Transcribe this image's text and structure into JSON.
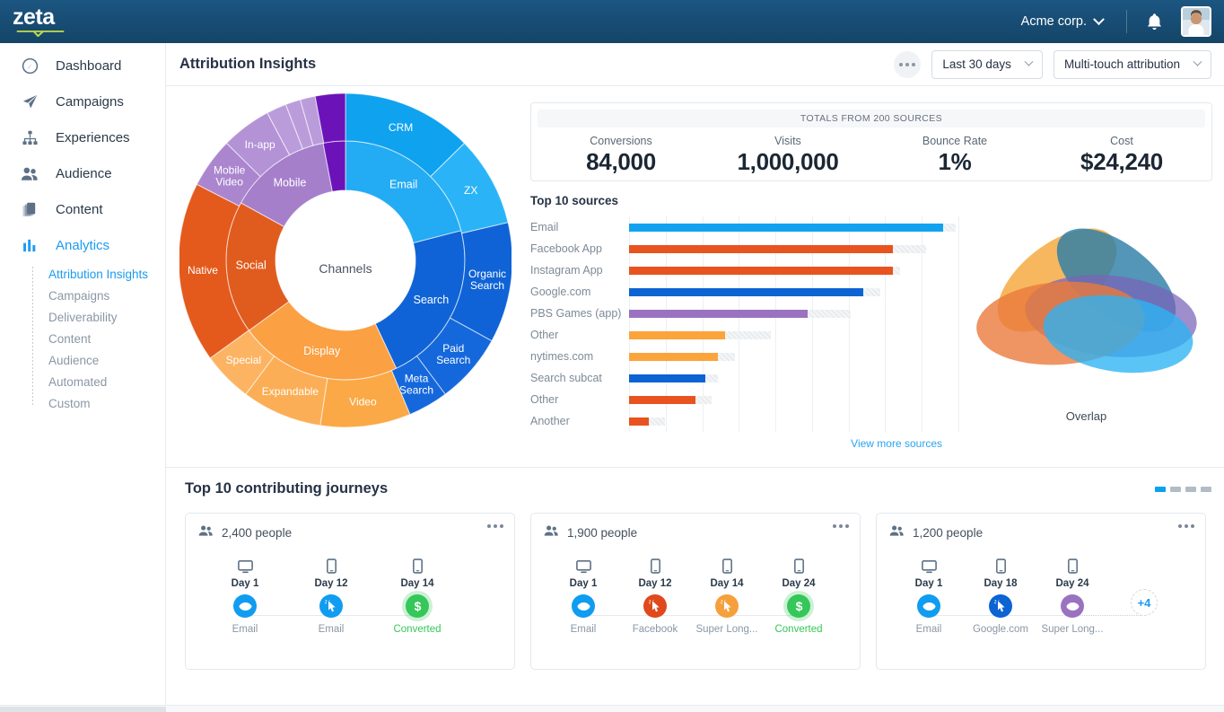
{
  "brand": {
    "logo_text": "zeta",
    "accent": "#1d9bf0",
    "topbar_bg": "#17507a"
  },
  "topbar": {
    "account": "Acme corp.",
    "bell_icon": "bell-icon",
    "avatar_icon": "user-avatar"
  },
  "sidebar": {
    "items": [
      {
        "label": "Dashboard",
        "icon": "gauge-icon"
      },
      {
        "label": "Campaigns",
        "icon": "paper-plane-icon"
      },
      {
        "label": "Experiences",
        "icon": "sitemap-icon"
      },
      {
        "label": "Audience",
        "icon": "people-icon"
      },
      {
        "label": "Content",
        "icon": "copy-icon"
      },
      {
        "label": "Analytics",
        "icon": "bar-chart-icon"
      }
    ],
    "subitems": [
      {
        "label": "Attribution Insights",
        "active": true
      },
      {
        "label": "Campaigns",
        "active": false
      },
      {
        "label": "Deliverability",
        "active": false
      },
      {
        "label": "Content",
        "active": false
      },
      {
        "label": "Audience",
        "active": false
      },
      {
        "label": "Automated",
        "active": false
      },
      {
        "label": "Custom",
        "active": false
      }
    ]
  },
  "header": {
    "title": "Attribution Insights",
    "more_icon": "ellipsis-icon",
    "date_range": "Last 30 days",
    "attribution_model": "Multi-touch attribution"
  },
  "stats": {
    "banner": "TOTALS FROM 200 SOURCES",
    "items": [
      {
        "label": "Conversions",
        "value": "84,000"
      },
      {
        "label": "Visits",
        "value": "1,000,000"
      },
      {
        "label": "Bounce Rate",
        "value": "1%"
      },
      {
        "label": "Cost",
        "value": "$24,240"
      }
    ]
  },
  "sources": {
    "title": "Top 10 sources",
    "view_more": "View more sources"
  },
  "overlap": {
    "label": "Overlap"
  },
  "journeys": {
    "title": "Top 10 contributing journeys",
    "pages": [
      true,
      false,
      false,
      false
    ],
    "cards": [
      {
        "people": "2,400 people",
        "people_icon": "people-icon",
        "more_icon": "ellipsis-icon",
        "extra": null,
        "steps": [
          {
            "device": "desktop-icon",
            "day": "Day 1",
            "action": "eye-icon",
            "color": "#109cf1",
            "name": "Email",
            "converted": false
          },
          {
            "device": "mobile-icon",
            "day": "Day 12",
            "action": "click-icon",
            "color": "#109cf1",
            "name": "Email",
            "converted": false
          },
          {
            "device": "mobile-icon",
            "day": "Day 14",
            "action": "dollar-icon",
            "color": "#35c759",
            "name": "Converted",
            "converted": true
          }
        ]
      },
      {
        "people": "1,900 people",
        "people_icon": "people-icon",
        "more_icon": "ellipsis-icon",
        "extra": null,
        "steps": [
          {
            "device": "desktop-icon",
            "day": "Day 1",
            "action": "eye-icon",
            "color": "#109cf1",
            "name": "Email",
            "converted": false
          },
          {
            "device": "mobile-icon",
            "day": "Day 12",
            "action": "click-icon",
            "color": "#e0491b",
            "name": "Facebook",
            "converted": false
          },
          {
            "device": "mobile-icon",
            "day": "Day 14",
            "action": "click-icon",
            "color": "#f6a03c",
            "name": "Super Long...",
            "converted": false
          },
          {
            "device": "mobile-icon",
            "day": "Day 24",
            "action": "dollar-icon",
            "color": "#35c759",
            "name": "Converted",
            "converted": true
          }
        ]
      },
      {
        "people": "1,200 people",
        "people_icon": "people-icon",
        "more_icon": "ellipsis-icon",
        "extra": "+4",
        "steps": [
          {
            "device": "desktop-icon",
            "day": "Day 1",
            "action": "eye-icon",
            "color": "#109cf1",
            "name": "Email",
            "converted": false
          },
          {
            "device": "mobile-icon",
            "day": "Day 18",
            "action": "click-icon",
            "color": "#0b63d4",
            "name": "Google.com",
            "converted": false
          },
          {
            "device": "mobile-icon",
            "day": "Day 24",
            "action": "eye-icon",
            "color": "#9b72c0",
            "name": "Super Long...",
            "converted": false
          }
        ]
      }
    ]
  },
  "chart_data": [
    {
      "type": "bar",
      "orientation": "horizontal",
      "title": "Top 10 sources",
      "xlabel": "",
      "ylabel": "",
      "grid": true,
      "categories": [
        "Email",
        "Facebook App",
        "Instagram App",
        "Google.com",
        "PBS Games (app)",
        "Other",
        "nytimes.com",
        "Search subcat",
        "Other",
        "Another"
      ],
      "values": [
        95,
        80,
        80,
        71,
        54,
        29,
        27,
        23,
        20,
        6
      ],
      "totals": [
        99,
        90,
        82,
        76,
        67,
        43,
        32,
        27,
        25,
        11
      ],
      "colors": [
        "#10a2ee",
        "#e8531f",
        "#e8531f",
        "#0b63d4",
        "#9b72c0",
        "#fba43c",
        "#fba43c",
        "#0b63d4",
        "#e8531f",
        "#e8531f"
      ],
      "remainder_color": "#e9ecef",
      "xlim": [
        0,
        100
      ]
    },
    {
      "type": "pie",
      "subtype": "sunburst",
      "title": "Channels",
      "center_label": "Channels",
      "inner_ring": [
        {
          "label": "Email",
          "value": 21,
          "color": "#23abf4"
        },
        {
          "label": "Search",
          "value": 22,
          "color": "#0f63d6"
        },
        {
          "label": "Display",
          "value": 22,
          "color": "#fba043"
        },
        {
          "label": "Social",
          "value": 18,
          "color": "#e05c1e"
        },
        {
          "label": "Mobile",
          "value": 14,
          "color": "#a67fcb"
        },
        {
          "label": "",
          "value": 3,
          "color": "#6b13b8"
        }
      ],
      "outer_ring": [
        {
          "label": "CRM",
          "value": 13,
          "color": "#0fa2ef"
        },
        {
          "label": "ZX",
          "value": 9,
          "color": "#2ab4f7"
        },
        {
          "label": "Organic Search",
          "value": 12,
          "color": "#0f63d6"
        },
        {
          "label": "Paid Search",
          "value": 7,
          "color": "#1568dc"
        },
        {
          "label": "Meta Search",
          "value": 4,
          "color": "#1568dc"
        },
        {
          "label": "Video",
          "value": 9,
          "color": "#fba946"
        },
        {
          "label": "Expandable",
          "value": 8,
          "color": "#fbae55"
        },
        {
          "label": "Special",
          "value": 5,
          "color": "#fcb463"
        },
        {
          "label": "Native",
          "value": 18,
          "color": "#e45a1c"
        },
        {
          "label": "Mobile Video",
          "value": 5,
          "color": "#ab86cf"
        },
        {
          "label": "In-app",
          "value": 5,
          "color": "#b492d6"
        },
        {
          "label": "",
          "value": 2,
          "color": "#bb9cdb"
        },
        {
          "label": "",
          "value": 1.5,
          "color": "#bb9cdb"
        },
        {
          "label": "",
          "value": 1.5,
          "color": "#bb9cdb"
        },
        {
          "label": "",
          "value": 3,
          "color": "#6b13b8"
        }
      ]
    },
    {
      "type": "area",
      "subtype": "venn",
      "title": "Overlap",
      "sets": [
        {
          "name": "set-amber",
          "color": "#f5a73c"
        },
        {
          "name": "set-teal",
          "color": "#2d7fa8"
        },
        {
          "name": "set-purple",
          "color": "#7a62b8"
        },
        {
          "name": "set-orange",
          "color": "#ea7a3c"
        },
        {
          "name": "set-cyan",
          "color": "#2bb3f3"
        }
      ]
    }
  ]
}
